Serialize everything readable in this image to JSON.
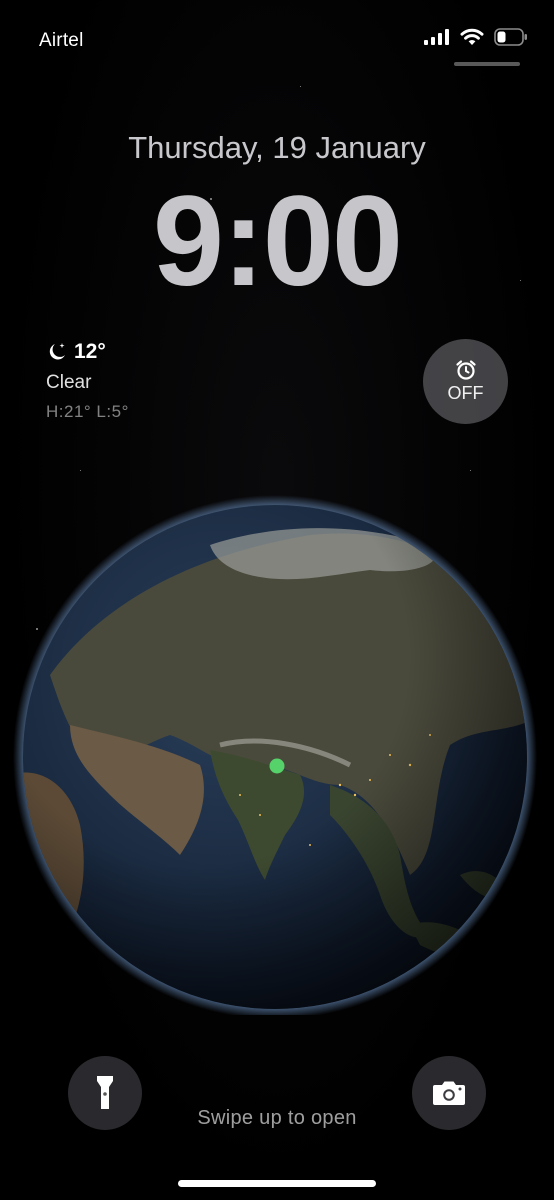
{
  "status_bar": {
    "carrier": "Airtel",
    "battery_level": 0.35
  },
  "lock_screen": {
    "date": "Thursday, 19 January",
    "time": "9:00"
  },
  "weather": {
    "icon": "moon-stars-icon",
    "temperature": "12°",
    "condition": "Clear",
    "high_low": "H:21° L:5°"
  },
  "alarm": {
    "icon": "alarm-clock-icon",
    "label": "OFF"
  },
  "wallpaper": {
    "type": "earth-globe",
    "marker_color": "#56d26a"
  },
  "quick_actions": {
    "flashlight_icon": "flashlight-icon",
    "camera_icon": "camera-icon"
  },
  "footer": {
    "swipe_hint": "Swipe up to open"
  }
}
